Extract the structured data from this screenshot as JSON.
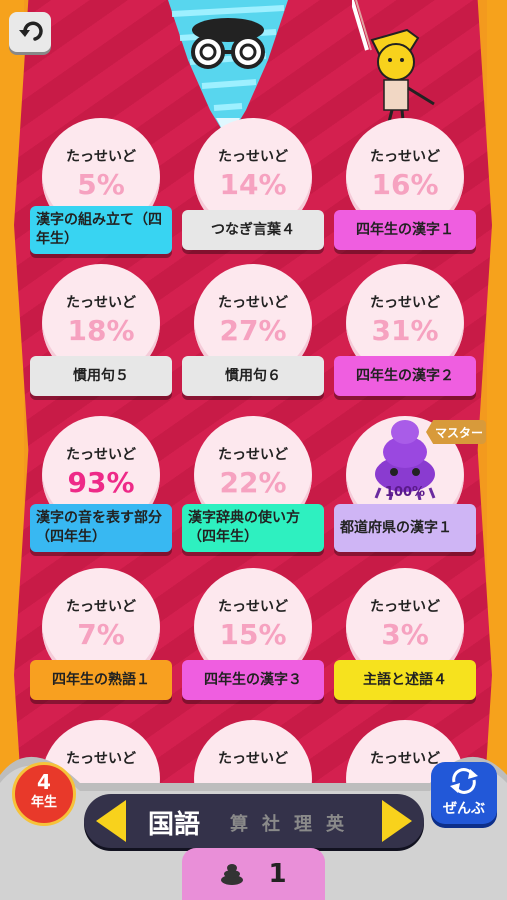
{
  "header": {
    "back_icon": "back-arrow-icon"
  },
  "cards": [
    {
      "label": "たっせいど",
      "percent": "5%",
      "title": "漢字の組み立て（四年生）",
      "color": "#38d4f2",
      "hot": false
    },
    {
      "label": "たっせいど",
      "percent": "14%",
      "title": "つなぎ言葉４",
      "color": "#e7e7e7",
      "hot": false
    },
    {
      "label": "たっせいど",
      "percent": "16%",
      "title": "四年生の漢字１",
      "color": "#ef5ee0",
      "hot": false
    },
    {
      "label": "たっせいど",
      "percent": "18%",
      "title": "慣用句５",
      "color": "#e7e7e7",
      "hot": false
    },
    {
      "label": "たっせいど",
      "percent": "27%",
      "title": "慣用句６",
      "color": "#e7e7e7",
      "hot": false
    },
    {
      "label": "たっせいど",
      "percent": "31%",
      "title": "四年生の漢字２",
      "color": "#ef5ee0",
      "hot": false
    },
    {
      "label": "たっせいど",
      "percent": "93%",
      "title": "漢字の音を表す部分（四年生）",
      "color": "#38b8f2",
      "hot": true
    },
    {
      "label": "たっせいど",
      "percent": "22%",
      "title": "漢字辞典の使い方（四年生）",
      "color": "#2ef0c0",
      "hot": false
    },
    {
      "label": "",
      "percent": "100%",
      "title": "都道府県の漢字１",
      "color": "#cfb5f5",
      "hot": false,
      "master": "マスター"
    },
    {
      "label": "たっせいど",
      "percent": "7%",
      "title": "四年生の熟語１",
      "color": "#f8a020",
      "hot": false
    },
    {
      "label": "たっせいど",
      "percent": "15%",
      "title": "四年生の漢字３",
      "color": "#ef5ee0",
      "hot": false
    },
    {
      "label": "たっせいど",
      "percent": "3%",
      "title": "主語と述語４",
      "color": "#f6e21e",
      "hot": false
    },
    {
      "label": "たっせいど",
      "percent": "",
      "title": "",
      "color": "#fde8ee",
      "hot": false
    },
    {
      "label": "たっせいど",
      "percent": "",
      "title": "",
      "color": "#fde8ee",
      "hot": false
    },
    {
      "label": "たっせいど",
      "percent": "",
      "title": "",
      "color": "#fde8ee",
      "hot": false
    }
  ],
  "footer": {
    "grade_num": "4",
    "grade_unit": "年生",
    "zenbu": "ぜんぶ",
    "subject_active": "国語",
    "subjects_inactive": [
      "算",
      "社",
      "理",
      "英"
    ],
    "count": "1"
  }
}
